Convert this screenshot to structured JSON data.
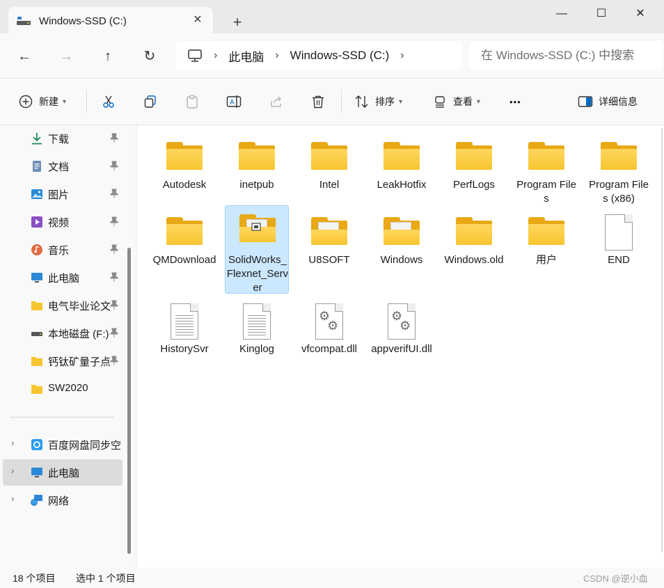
{
  "window": {
    "tab_title": "Windows-SSD (C:)",
    "tab_close": "✕",
    "new_tab": "+",
    "minimize": "—",
    "maximize": "☐",
    "close": "✕"
  },
  "nav": {
    "back": "←",
    "forward": "→",
    "up": "↑",
    "refresh": "↻",
    "breadcrumb": [
      "此电脑",
      "Windows-SSD (C:)"
    ],
    "breadcrumb_sep": "›",
    "search_placeholder": "在 Windows-SSD (C:) 中搜索"
  },
  "toolbar": {
    "new_label": "新建",
    "sort_label": "排序",
    "view_label": "查看",
    "more": "•••",
    "details_label": "详细信息"
  },
  "sidebar": {
    "quick": [
      {
        "label": "下载",
        "icon": "download-icon",
        "pinned": true
      },
      {
        "label": "文档",
        "icon": "documents-icon",
        "pinned": true
      },
      {
        "label": "图片",
        "icon": "pictures-icon",
        "pinned": true
      },
      {
        "label": "视频",
        "icon": "videos-icon",
        "pinned": true
      },
      {
        "label": "音乐",
        "icon": "music-icon",
        "pinned": true
      },
      {
        "label": "此电脑",
        "icon": "this-pc-icon",
        "pinned": true
      },
      {
        "label": "电气毕业论文",
        "icon": "folder-icon",
        "pinned": true
      },
      {
        "label": "本地磁盘 (F:)",
        "icon": "drive-icon",
        "pinned": true
      },
      {
        "label": "钙钛矿量子点",
        "icon": "folder-icon",
        "pinned": true
      },
      {
        "label": "SW2020",
        "icon": "folder-icon",
        "pinned": false
      }
    ],
    "tree": [
      {
        "label": "百度网盘同步空间",
        "icon": "baidu-netdisk-icon",
        "selected": false
      },
      {
        "label": "此电脑",
        "icon": "this-pc-icon",
        "selected": true
      },
      {
        "label": "网络",
        "icon": "network-icon",
        "selected": false
      }
    ],
    "pin_glyph": "📌",
    "expand_glyph": "›"
  },
  "items": [
    {
      "name": "Autodesk",
      "type": "folder"
    },
    {
      "name": "inetpub",
      "type": "folder"
    },
    {
      "name": "Intel",
      "type": "folder"
    },
    {
      "name": "LeakHotfix",
      "type": "folder"
    },
    {
      "name": "PerfLogs",
      "type": "folder"
    },
    {
      "name": "Program Files",
      "type": "folder"
    },
    {
      "name": "Program Files (x86)",
      "type": "folder"
    },
    {
      "name": "QMDownload",
      "type": "folder"
    },
    {
      "name": "SolidWorks_Flexnet_Server",
      "type": "folder-doc",
      "selected": true
    },
    {
      "name": "U8SOFT",
      "type": "folder-doc"
    },
    {
      "name": "Windows",
      "type": "folder-doc"
    },
    {
      "name": "Windows.old",
      "type": "folder"
    },
    {
      "name": "用户",
      "type": "folder"
    },
    {
      "name": "END",
      "type": "file"
    },
    {
      "name": "HistorySvr",
      "type": "text"
    },
    {
      "name": "Kinglog",
      "type": "text"
    },
    {
      "name": "vfcompat.dll",
      "type": "dll"
    },
    {
      "name": "appverifUI.dll",
      "type": "dll"
    }
  ],
  "status": {
    "count": "18 个项目",
    "selection": "选中 1 个项目",
    "watermark": "CSDN @逆小血"
  },
  "colors": {
    "folder": "#f7c531",
    "selection": "#cce8ff",
    "accent": "#0067c0"
  }
}
